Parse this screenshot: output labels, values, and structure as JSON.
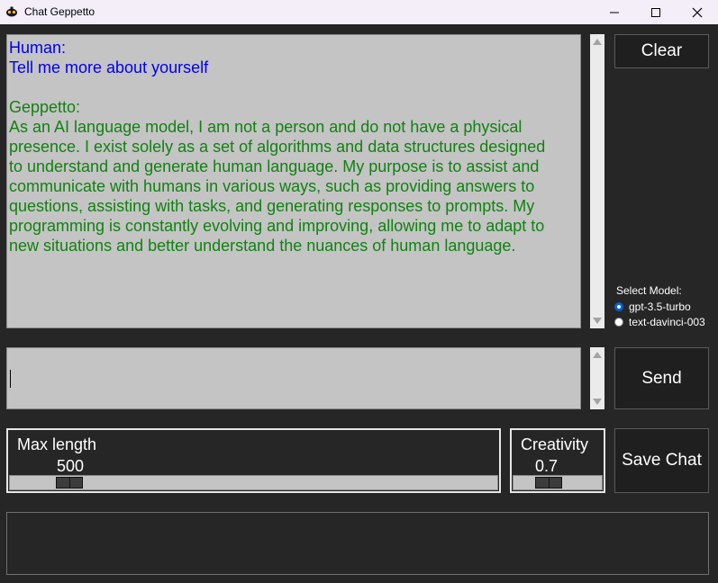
{
  "window": {
    "title": "Chat Geppetto"
  },
  "chat": {
    "human_label": "Human:",
    "human_message": "Tell me more about yourself",
    "bot_label": "Geppetto:",
    "bot_lines": [
      "As an AI language model, I am not a person and do not have a physical",
      "presence. I exist solely as a set of algorithms and data structures designed",
      "to understand and generate human language. My purpose is to assist and",
      "communicate with humans in various ways, such as providing answers to",
      "questions, assisting with tasks, and generating responses to prompts. My",
      "programming is constantly evolving and improving, allowing me to adapt to",
      "new situations and better understand the nuances of human language."
    ]
  },
  "buttons": {
    "clear": "Clear",
    "send": "Send",
    "save": "Save Chat"
  },
  "model": {
    "label": "Select Model:",
    "options": [
      "gpt-3.5-turbo",
      "text-davinci-003"
    ],
    "selected": "gpt-3.5-turbo"
  },
  "input": {
    "value": ""
  },
  "max_length": {
    "label": "Max length",
    "value": "500",
    "fraction": 0.1
  },
  "creativity": {
    "label": "Creativity",
    "value": "0.7",
    "fraction": 0.35
  },
  "colors": {
    "human": "#0000ee",
    "bot": "#118211",
    "accent": "#0064d2"
  }
}
